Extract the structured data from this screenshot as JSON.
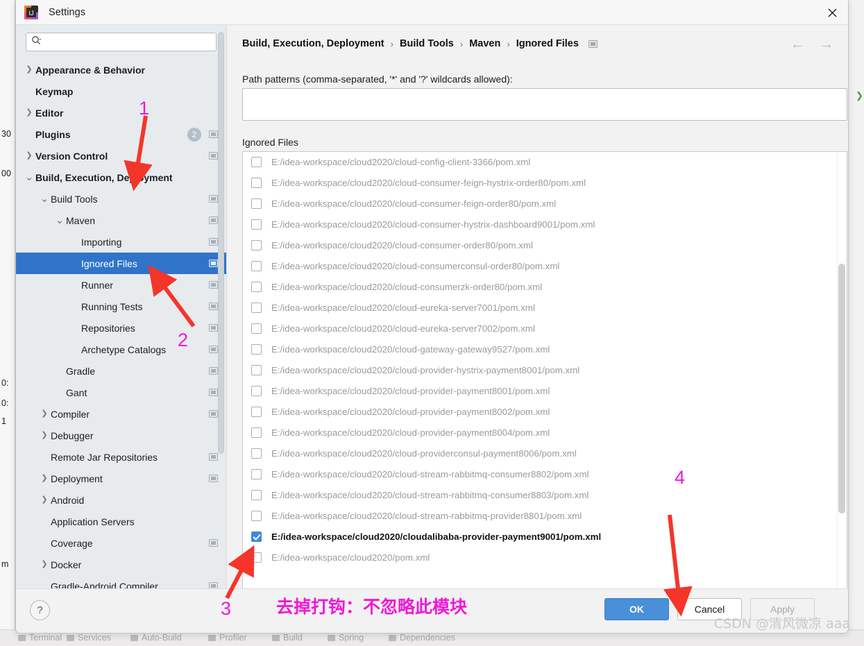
{
  "window": {
    "title": "Settings",
    "app_icon": "intellij-idea-icon",
    "close_icon": "close-icon"
  },
  "sidebar": {
    "search": {
      "placeholder": "",
      "value": "",
      "icon": "search-icon"
    },
    "items": [
      {
        "label": "Appearance & Behavior",
        "indent": 0,
        "chevron": "right",
        "bold": true,
        "badge": "",
        "modified": false
      },
      {
        "label": "Keymap",
        "indent": 0,
        "chevron": "",
        "bold": true,
        "badge": "",
        "modified": false
      },
      {
        "label": "Editor",
        "indent": 0,
        "chevron": "right",
        "bold": true,
        "badge": "",
        "modified": false
      },
      {
        "label": "Plugins",
        "indent": 0,
        "chevron": "",
        "bold": true,
        "badge": "2",
        "modified": true
      },
      {
        "label": "Version Control",
        "indent": 0,
        "chevron": "right",
        "bold": true,
        "badge": "",
        "modified": true
      },
      {
        "label": "Build, Execution, Deployment",
        "indent": 0,
        "chevron": "down",
        "bold": true,
        "badge": "",
        "modified": false
      },
      {
        "label": "Build Tools",
        "indent": 1,
        "chevron": "down",
        "bold": false,
        "badge": "",
        "modified": true
      },
      {
        "label": "Maven",
        "indent": 2,
        "chevron": "down",
        "bold": false,
        "badge": "",
        "modified": true
      },
      {
        "label": "Importing",
        "indent": 3,
        "chevron": "",
        "bold": false,
        "badge": "",
        "modified": true
      },
      {
        "label": "Ignored Files",
        "indent": 3,
        "chevron": "",
        "bold": false,
        "badge": "",
        "modified": true,
        "selected": true
      },
      {
        "label": "Runner",
        "indent": 3,
        "chevron": "",
        "bold": false,
        "badge": "",
        "modified": true
      },
      {
        "label": "Running Tests",
        "indent": 3,
        "chevron": "",
        "bold": false,
        "badge": "",
        "modified": true
      },
      {
        "label": "Repositories",
        "indent": 3,
        "chevron": "",
        "bold": false,
        "badge": "",
        "modified": true
      },
      {
        "label": "Archetype Catalogs",
        "indent": 3,
        "chevron": "",
        "bold": false,
        "badge": "",
        "modified": true
      },
      {
        "label": "Gradle",
        "indent": 2,
        "chevron": "",
        "bold": false,
        "badge": "",
        "modified": true
      },
      {
        "label": "Gant",
        "indent": 2,
        "chevron": "",
        "bold": false,
        "badge": "",
        "modified": true
      },
      {
        "label": "Compiler",
        "indent": 1,
        "chevron": "right",
        "bold": false,
        "badge": "",
        "modified": true
      },
      {
        "label": "Debugger",
        "indent": 1,
        "chevron": "right",
        "bold": false,
        "badge": "",
        "modified": false
      },
      {
        "label": "Remote Jar Repositories",
        "indent": 1,
        "chevron": "",
        "bold": false,
        "badge": "",
        "modified": true
      },
      {
        "label": "Deployment",
        "indent": 1,
        "chevron": "right",
        "bold": false,
        "badge": "",
        "modified": true
      },
      {
        "label": "Android",
        "indent": 1,
        "chevron": "right",
        "bold": false,
        "badge": "",
        "modified": false
      },
      {
        "label": "Application Servers",
        "indent": 1,
        "chevron": "",
        "bold": false,
        "badge": "",
        "modified": false
      },
      {
        "label": "Coverage",
        "indent": 1,
        "chevron": "",
        "bold": false,
        "badge": "",
        "modified": true
      },
      {
        "label": "Docker",
        "indent": 1,
        "chevron": "right",
        "bold": false,
        "badge": "",
        "modified": false
      },
      {
        "label": "Gradle-Android Compiler",
        "indent": 1,
        "chevron": "",
        "bold": false,
        "badge": "",
        "modified": true
      }
    ]
  },
  "main": {
    "breadcrumb": [
      "Build, Execution, Deployment",
      "Build Tools",
      "Maven",
      "Ignored Files"
    ],
    "breadcrumb_separator": "›",
    "nav_back_icon": "arrow-left-icon",
    "nav_forward_icon": "arrow-right-icon",
    "path_patterns_label": "Path patterns (comma-separated, '*' and '?' wildcards allowed):",
    "path_patterns_value": "",
    "ignored_files_label": "Ignored Files",
    "files": [
      {
        "path": "E:/idea-workspace/cloud2020/cloud-config-client-3366/pom.xml",
        "checked": false
      },
      {
        "path": "E:/idea-workspace/cloud2020/cloud-consumer-feign-hystrix-order80/pom.xml",
        "checked": false
      },
      {
        "path": "E:/idea-workspace/cloud2020/cloud-consumer-feign-order80/pom.xml",
        "checked": false
      },
      {
        "path": "E:/idea-workspace/cloud2020/cloud-consumer-hystrix-dashboard9001/pom.xml",
        "checked": false
      },
      {
        "path": "E:/idea-workspace/cloud2020/cloud-consumer-order80/pom.xml",
        "checked": false
      },
      {
        "path": "E:/idea-workspace/cloud2020/cloud-consumerconsul-order80/pom.xml",
        "checked": false
      },
      {
        "path": "E:/idea-workspace/cloud2020/cloud-consumerzk-order80/pom.xml",
        "checked": false
      },
      {
        "path": "E:/idea-workspace/cloud2020/cloud-eureka-server7001/pom.xml",
        "checked": false
      },
      {
        "path": "E:/idea-workspace/cloud2020/cloud-eureka-server7002/pom.xml",
        "checked": false
      },
      {
        "path": "E:/idea-workspace/cloud2020/cloud-gateway-gateway9527/pom.xml",
        "checked": false
      },
      {
        "path": "E:/idea-workspace/cloud2020/cloud-provider-hystrix-payment8001/pom.xml",
        "checked": false
      },
      {
        "path": "E:/idea-workspace/cloud2020/cloud-provider-payment8001/pom.xml",
        "checked": false
      },
      {
        "path": "E:/idea-workspace/cloud2020/cloud-provider-payment8002/pom.xml",
        "checked": false
      },
      {
        "path": "E:/idea-workspace/cloud2020/cloud-provider-payment8004/pom.xml",
        "checked": false
      },
      {
        "path": "E:/idea-workspace/cloud2020/cloud-providerconsul-payment8006/pom.xml",
        "checked": false
      },
      {
        "path": "E:/idea-workspace/cloud2020/cloud-stream-rabbitmq-consumer8802/pom.xml",
        "checked": false
      },
      {
        "path": "E:/idea-workspace/cloud2020/cloud-stream-rabbitmq-consumer8803/pom.xml",
        "checked": false
      },
      {
        "path": "E:/idea-workspace/cloud2020/cloud-stream-rabbitmq-provider8801/pom.xml",
        "checked": false
      },
      {
        "path": "E:/idea-workspace/cloud2020/cloudalibaba-provider-payment9001/pom.xml",
        "checked": true
      },
      {
        "path": "E:/idea-workspace/cloud2020/pom.xml",
        "checked": false
      }
    ]
  },
  "footer": {
    "help_label": "?",
    "ok_label": "OK",
    "cancel_label": "Cancel",
    "apply_label": "Apply"
  },
  "annotations": {
    "accent_color": "#f018d8",
    "arrow_color": "#f5352a",
    "numbers": [
      "1",
      "2",
      "3",
      "4"
    ],
    "note_cn": "去掉打钩：不忽略此模块",
    "watermark": "CSDN @清风微凉 aaa"
  },
  "ide_background": {
    "left_fragments": [
      "30",
      "00",
      "0:",
      "0:",
      "1",
      "m"
    ],
    "bottom_tabs": [
      "Terminal",
      "Services",
      "Auto-Build",
      "Profiler",
      "Build",
      "Spring",
      "Dependencies"
    ]
  }
}
